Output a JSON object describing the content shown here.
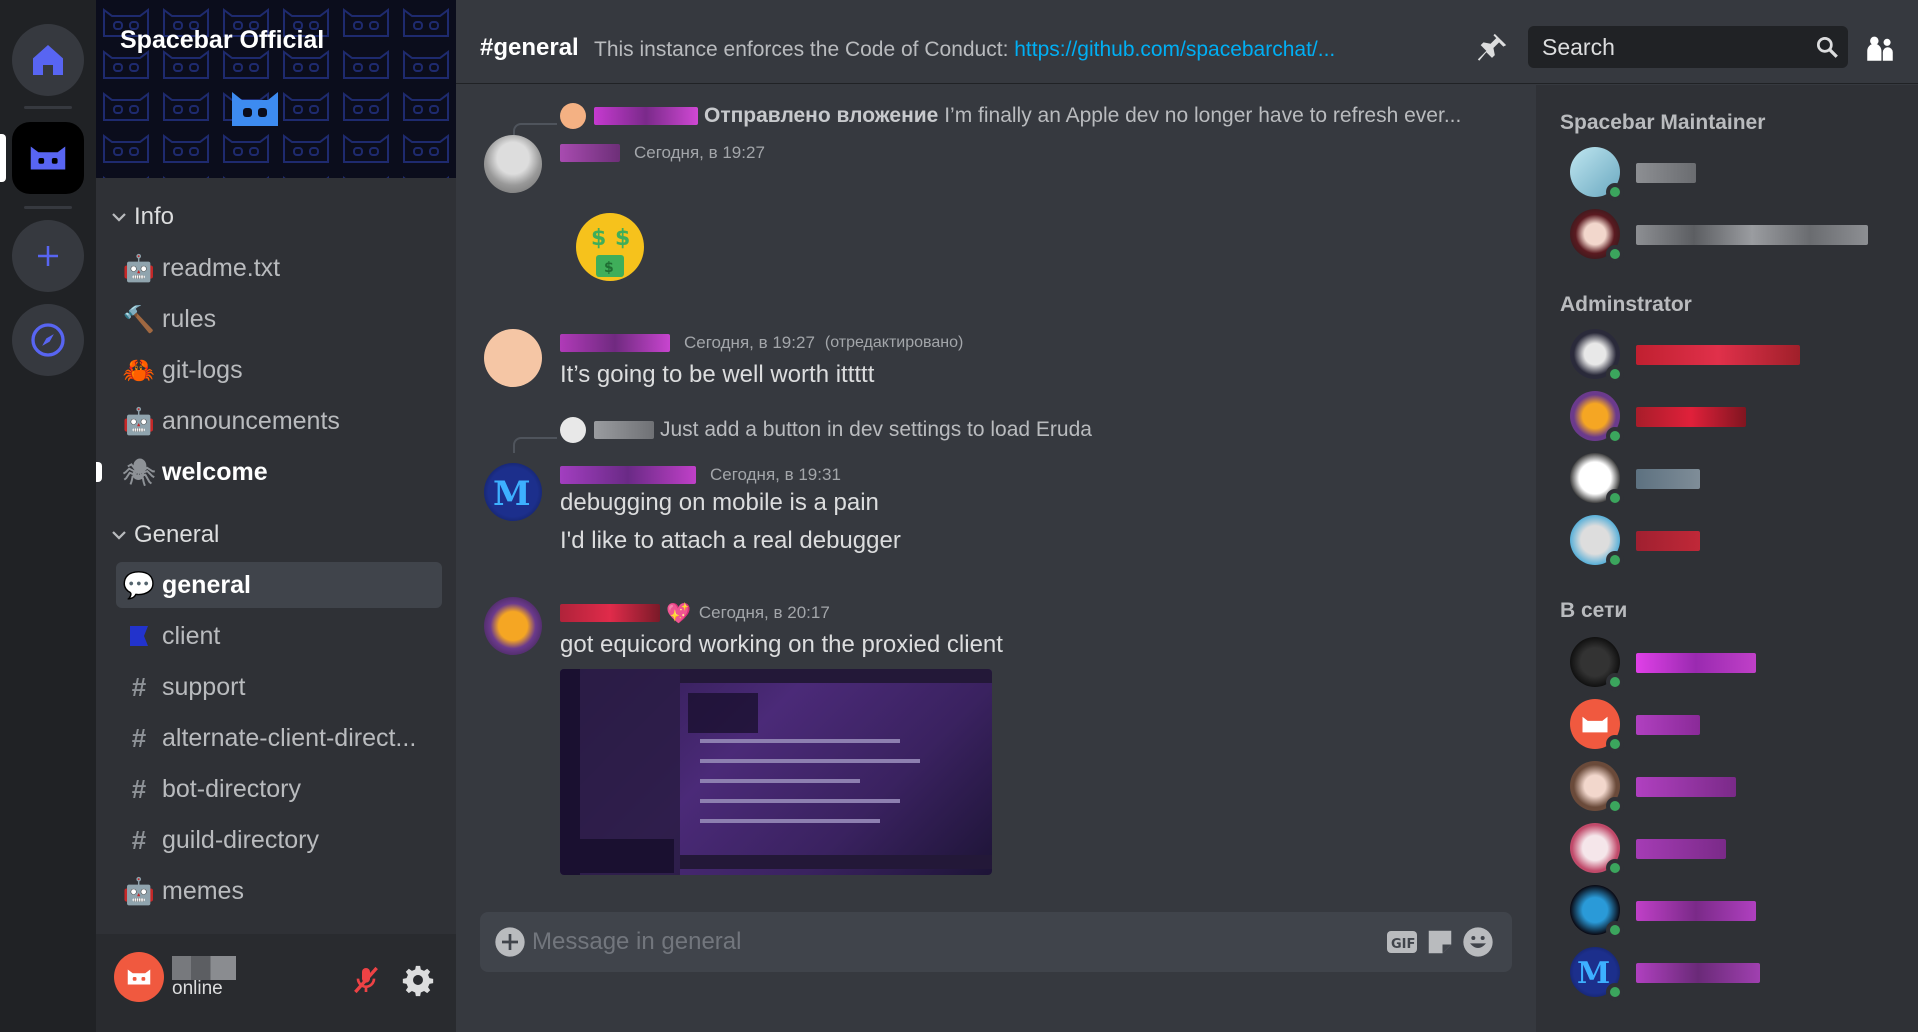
{
  "server": {
    "name": "Spacebar Official"
  },
  "rail": {
    "home_icon": "home-icon",
    "server_icon": "spacebar-logo-icon",
    "add_icon": "plus-icon",
    "explore_icon": "compass-icon"
  },
  "sidebar": {
    "categories": [
      {
        "label": "Info"
      },
      {
        "label": "General"
      }
    ],
    "channels": [
      {
        "name": "readme.txt",
        "icon": "robot-icon"
      },
      {
        "name": "rules",
        "icon": "hammer-icon"
      },
      {
        "name": "git-logs",
        "icon": "crab-icon"
      },
      {
        "name": "announcements",
        "icon": "robot-icon"
      },
      {
        "name": "welcome",
        "icon": "spider-icon"
      },
      {
        "name": "general",
        "icon": "chat-icon"
      },
      {
        "name": "client",
        "icon": "flag-icon"
      },
      {
        "name": "support",
        "icon": "hash-icon"
      },
      {
        "name": "alternate-client-direct...",
        "icon": "hash-icon"
      },
      {
        "name": "bot-directory",
        "icon": "hash-icon"
      },
      {
        "name": "guild-directory",
        "icon": "hash-icon"
      },
      {
        "name": "memes",
        "icon": "robot-icon"
      }
    ]
  },
  "userbar": {
    "status": "online"
  },
  "header": {
    "channel": "#general",
    "topic_prefix": "This instance enforces the Code of Conduct: ",
    "topic_link": "https://github.com/spacebarchat/...",
    "search_placeholder": "Search"
  },
  "messages": [
    {
      "reply_text": "Отправлено вложение",
      "reply_snippet": "I’m finally an Apple dev no longer have to refresh ever...",
      "timestamp": "Сегодня, в 19:27",
      "emoji": "money-mouth-face"
    },
    {
      "timestamp": "Сегодня, в 19:27",
      "edited": "(отредактировано)",
      "lines": [
        "It’s going to be well worth ittttt"
      ]
    },
    {
      "reply_snippet": "Just add a button in dev settings to load Eruda",
      "timestamp": "Сегодня, в 19:31",
      "lines": [
        "debugging on mobile is a pain",
        "I'd like to attach a real debugger"
      ]
    },
    {
      "timestamp": "Сегодня, в 20:17",
      "lines": [
        "got equicord working on the proxied client"
      ]
    }
  ],
  "composer": {
    "placeholder": "Message in general"
  },
  "members": {
    "groups": [
      {
        "label": "Spacebar Maintainer"
      },
      {
        "label": "Adminstrator"
      },
      {
        "label": "В сети"
      }
    ]
  },
  "colors": {
    "accent": "#5865f2",
    "online": "#3ba55d",
    "link": "#00aff4"
  }
}
